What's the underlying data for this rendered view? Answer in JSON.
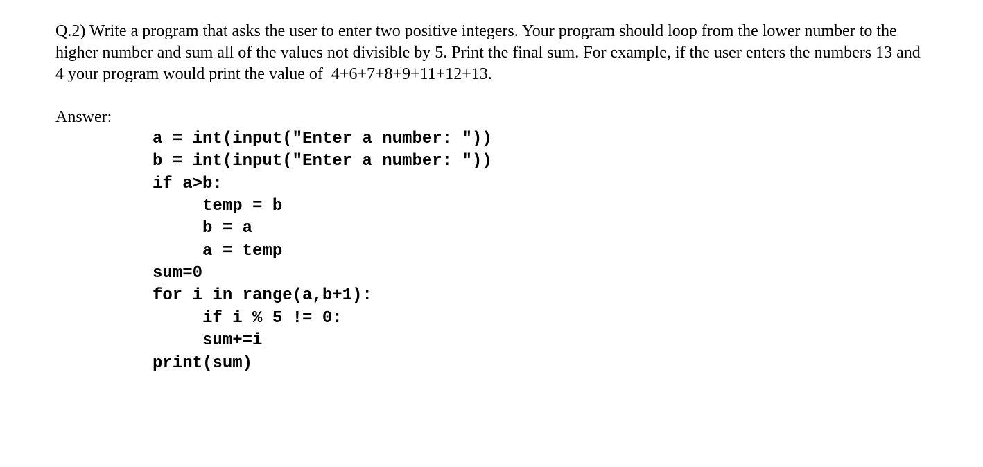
{
  "question": {
    "text": "Q.2) Write a program that asks the user to enter two positive integers. Your program should loop from the lower number to the higher number and sum all of the values not divisible by 5. Print the final sum. For example, if the user enters the numbers 13 and 4 your program would print the value of  4+6+7+8+9+11+12+13."
  },
  "answer_label": "Answer:",
  "code": {
    "line1": "a = int(input(\"Enter a number: \"))",
    "line2": "b = int(input(\"Enter a number: \"))",
    "line3": "if a>b:",
    "line4": "     temp = b",
    "line5": "     b = a",
    "line6": "     a = temp",
    "line7": "sum=0",
    "line8": "for i in range(a,b+1):",
    "line9": "     if i % 5 != 0:",
    "line10": "     sum+=i",
    "line11": "print(sum)"
  }
}
